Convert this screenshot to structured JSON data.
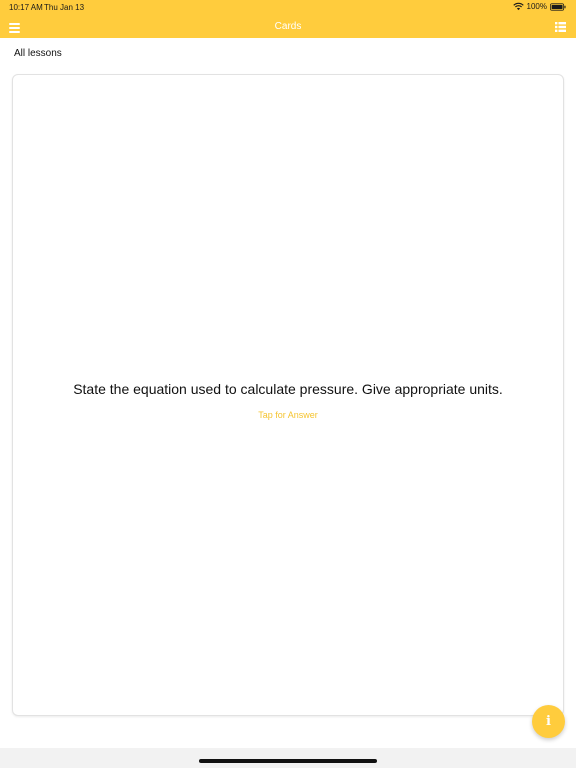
{
  "status_bar": {
    "time": "10:17 AM",
    "date": "Thu Jan 13",
    "battery": "100%"
  },
  "nav": {
    "title": "Cards",
    "left_icon": "hamburger-menu-icon",
    "right_icon": "list-icon"
  },
  "lessons_label": "All lessons",
  "card": {
    "question": "State the equation used to calculate pressure. Give appropriate units.",
    "tap_label": "Tap for Answer"
  },
  "info_button": {
    "icon": "info-icon"
  },
  "colors": {
    "accent": "#ffcc3d",
    "tap_text": "#f5c430",
    "bottom_bar": "#f2f2f2"
  }
}
